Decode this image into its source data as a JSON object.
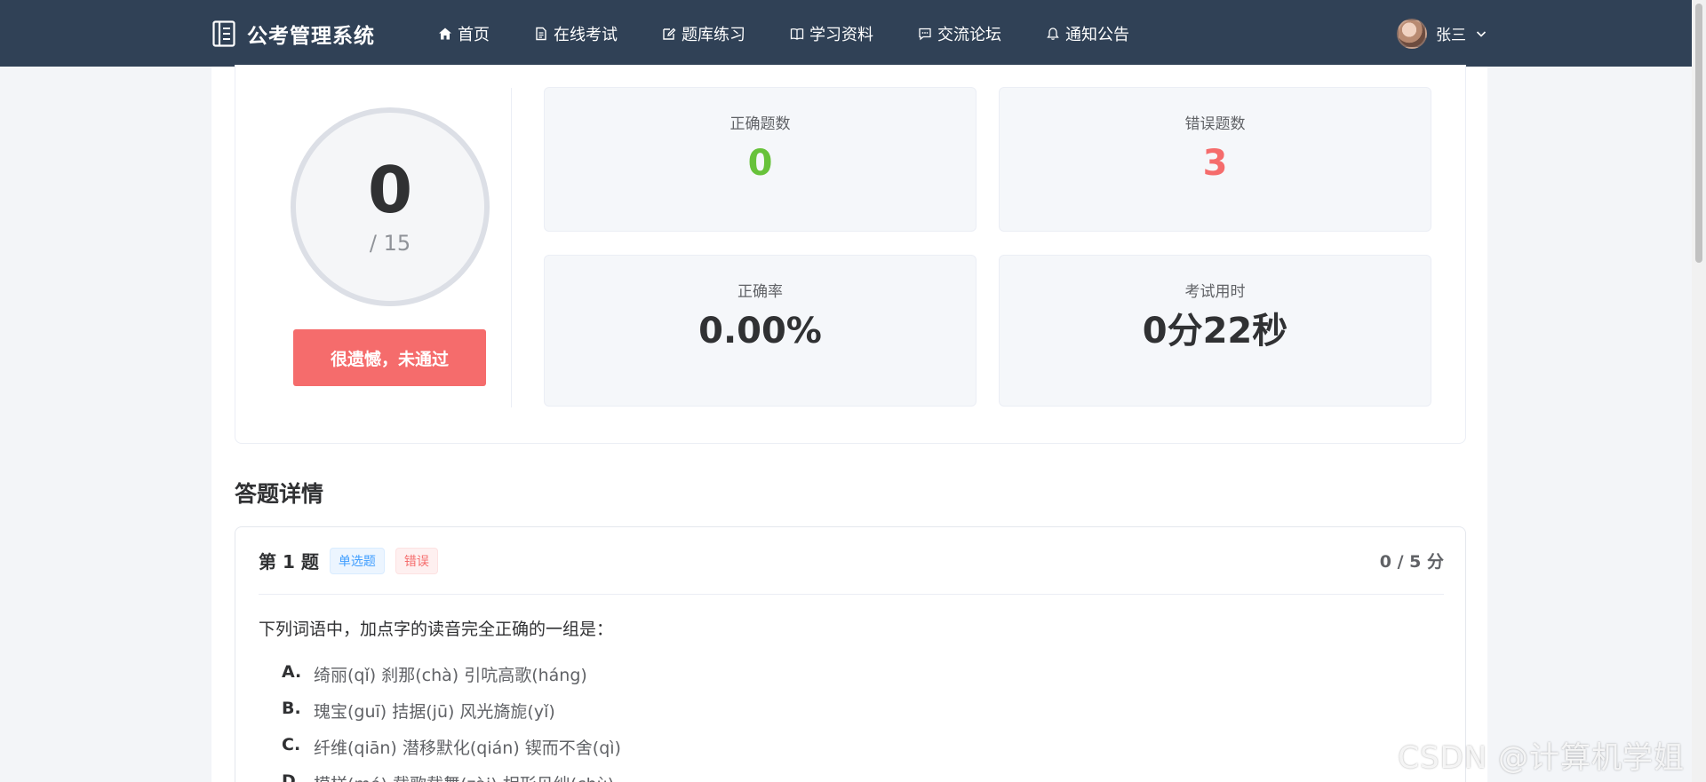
{
  "header": {
    "app_title": "公考管理系统",
    "nav": [
      {
        "label": "首页",
        "icon": "home-icon"
      },
      {
        "label": "在线考试",
        "icon": "document-icon"
      },
      {
        "label": "题库练习",
        "icon": "edit-icon"
      },
      {
        "label": "学习资料",
        "icon": "book-icon"
      },
      {
        "label": "交流论坛",
        "icon": "chat-icon"
      },
      {
        "label": "通知公告",
        "icon": "bell-icon"
      }
    ],
    "user_name": "张三"
  },
  "result": {
    "score": "0",
    "total": "/ 15",
    "status_label": "很遗憾，未通过",
    "stats": {
      "correct_label": "正确题数",
      "correct_value": "0",
      "wrong_label": "错误题数",
      "wrong_value": "3",
      "accuracy_label": "正确率",
      "accuracy_value": "0.00%",
      "time_label": "考试用时",
      "time_value": "0分22秒"
    },
    "colors": {
      "correct": "#67c23a",
      "wrong": "#f56c6c"
    }
  },
  "details": {
    "section_title": "答题详情",
    "question": {
      "number": "第 1 题",
      "type_tag": "单选题",
      "result_tag": "错误",
      "score": "0 / 5 分",
      "text": "下列词语中，加点字的读音完全正确的一组是：",
      "options": [
        {
          "key": "A.",
          "text": "绮丽(qǐ) 刹那(chà) 引吭高歌(háng)"
        },
        {
          "key": "B.",
          "text": "瑰宝(guī) 拮据(jū) 风光旖旎(yǐ)"
        },
        {
          "key": "C.",
          "text": "纤维(qiān) 潜移默化(qián) 锲而不舍(qì)"
        },
        {
          "key": "D.",
          "text": "模样(mó) 载歌载舞(zài) 相形见绌(chù)"
        }
      ]
    }
  },
  "watermark": "CSDN @计算机学姐"
}
